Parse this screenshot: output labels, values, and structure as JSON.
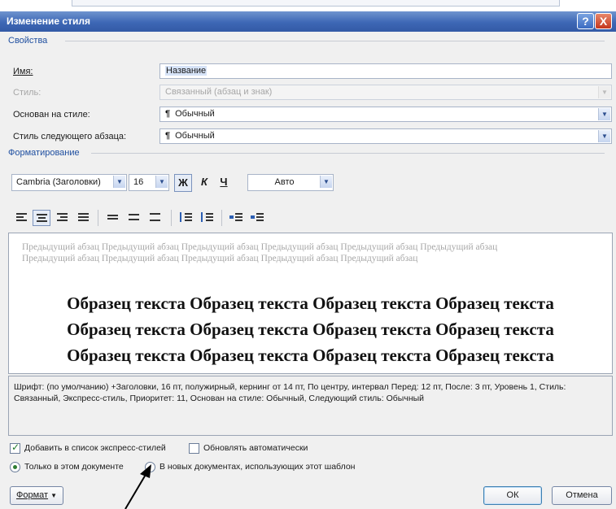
{
  "window": {
    "title": "Изменение стиля",
    "help_glyph": "?",
    "close_glyph": "X"
  },
  "properties": {
    "heading": "Свойства",
    "name_label": "Имя:",
    "name_value": "Название",
    "type_label": "Стиль:",
    "type_value": "Связанный (абзац и знак)",
    "based_label": "Основан на стиле:",
    "based_value": "Обычный",
    "next_label": "Стиль следующего абзаца:",
    "next_value": "Обычный",
    "paragraph_mark": "¶"
  },
  "formatting": {
    "heading": "Форматирование",
    "font_name": "Cambria (Заголовки)",
    "font_size": "16",
    "bold_glyph": "Ж",
    "italic_glyph": "К",
    "underline_glyph": "Ч",
    "color_value": "Авто"
  },
  "preview": {
    "previous_paragraph": "Предыдущий абзац Предыдущий абзац Предыдущий абзац Предыдущий абзац Предыдущий абзац Предыдущий абзац Предыдущий абзац Предыдущий абзац Предыдущий абзац Предыдущий абзац Предыдущий абзац",
    "sample_line": "Образец текста Образец текста Образец текста Образец текста"
  },
  "description": "Шрифт: (по умолчанию) +Заголовки, 16 пт, полужирный, кернинг от 14 пт, По центру, интервал Перед: 12 пт, После: 3 пт, Уровень 1, Стиль: Связанный, Экспресс-стиль, Приоритет: 11, Основан на стиле: Обычный, Следующий стиль: Обычный",
  "options": {
    "add_to_quick_styles": "Добавить в список экспресс-стилей",
    "auto_update": "Обновлять автоматически",
    "only_this_document": "Только в этом документе",
    "new_documents": "В новых документах, использующих этот шаблон"
  },
  "buttons": {
    "format": "Формат",
    "ok": "ОК",
    "cancel": "Отмена"
  },
  "colors": {
    "title_bar": "#3d67b5",
    "section_heading": "#1f4fa0",
    "selection": "#d6e3f7"
  }
}
